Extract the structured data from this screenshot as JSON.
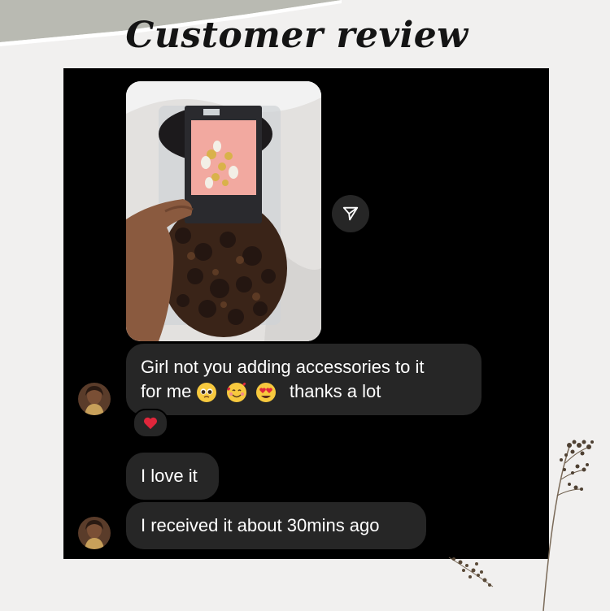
{
  "header": {
    "title": "Customer review"
  },
  "conversation": {
    "messages": [
      {
        "line1": "Girl not you adding accessories to it",
        "line2_prefix": "for me",
        "line2_suffix": "thanks a lot",
        "emojis": [
          "pleading-face",
          "smiling-face-with-hearts",
          "heart-eyes-face"
        ],
        "reaction": "red-heart"
      },
      {
        "text": "I love it"
      },
      {
        "text": "I received it about 30mins ago"
      }
    ]
  },
  "colors": {
    "background": "#f1f0ef",
    "panel": "#000000",
    "bubble": "#262626",
    "text": "#ffffff",
    "reaction_heart": "#e0263b"
  }
}
